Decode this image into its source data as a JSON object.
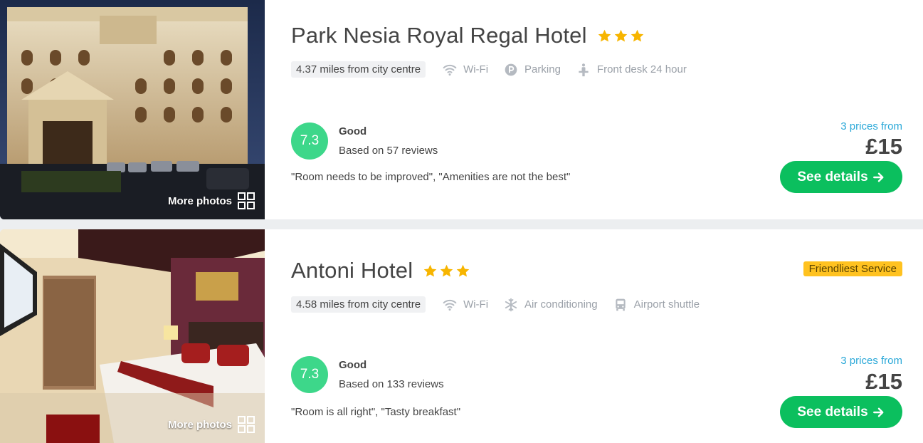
{
  "hotels": [
    {
      "name": "Park Nesia Royal Regal Hotel",
      "stars": 3,
      "distance": "4.37 miles from city centre",
      "amenities": [
        {
          "icon": "wifi-icon",
          "label": "Wi-Fi"
        },
        {
          "icon": "parking-icon",
          "label": "Parking"
        },
        {
          "icon": "front-desk-icon",
          "label": "Front desk 24 hour"
        }
      ],
      "score": "7.3",
      "rating_label": "Good",
      "reviews": "Based on 57 reviews",
      "quotes": "\"Room needs to be improved\", \"Amenities are not the best\"",
      "badge": "",
      "prices_from": "3 prices from",
      "price": "£15",
      "button": "See details",
      "more_photos": "More photos"
    },
    {
      "name": "Antoni Hotel",
      "stars": 3,
      "distance": "4.58 miles from city centre",
      "amenities": [
        {
          "icon": "wifi-icon",
          "label": "Wi-Fi"
        },
        {
          "icon": "snowflake-icon",
          "label": "Air conditioning"
        },
        {
          "icon": "shuttle-icon",
          "label": "Airport shuttle"
        }
      ],
      "score": "7.3",
      "rating_label": "Good",
      "reviews": "Based on 133 reviews",
      "quotes": "\"Room is all right\", \"Tasty breakfast\"",
      "badge": "Friendliest Service",
      "prices_from": "3 prices from",
      "price": "£15",
      "button": "See details",
      "more_photos": "More photos"
    }
  ],
  "colors": {
    "score_bg": "#3dd78a",
    "button_bg": "#0bbf5e",
    "star": "#f7b500",
    "badge_bg": "#ffc220",
    "prices_from": "#2aa8d8"
  }
}
